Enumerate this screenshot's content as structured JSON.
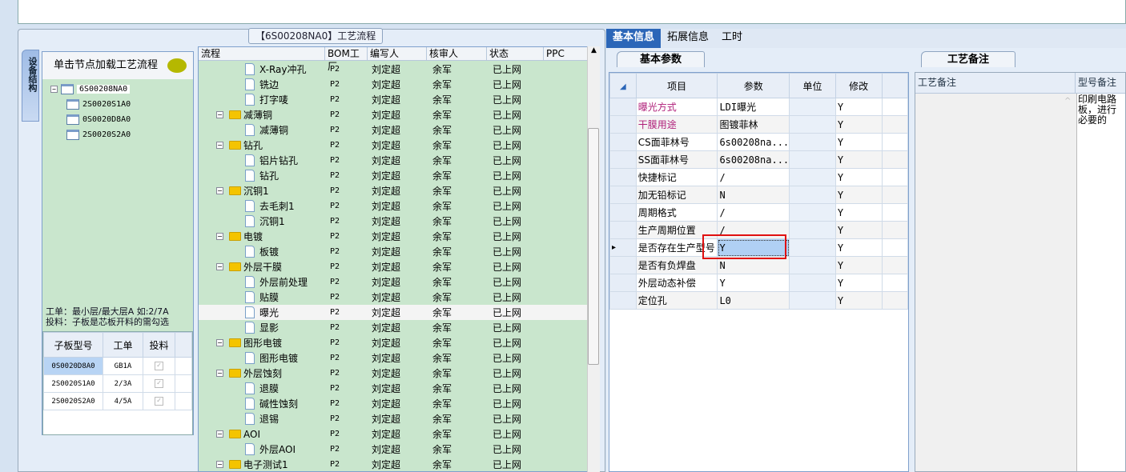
{
  "flow_title": "【6S00208NA0】工艺流程",
  "side_tab": "设备结构",
  "tree": {
    "header": "单击节点加载工艺流程",
    "root": "6S00208NA0",
    "children": [
      "2S0020S1A0",
      "0S0020D8A0",
      "2S0020S2A0"
    ]
  },
  "hint": [
    "工单：最小层/最大层A 如:2/7A",
    "投料：子板是芯板开料的需勾选"
  ],
  "sub_table": {
    "headers": [
      "子板型号",
      "工单",
      "投料"
    ],
    "rows": [
      [
        "0S0020D8A0",
        "GB1A",
        true
      ],
      [
        "2S0020S1A0",
        "2/3A",
        true
      ],
      [
        "2S0020S2A0",
        "4/5A",
        true
      ]
    ]
  },
  "flow_table": {
    "headers": [
      "流程",
      "BOM工厂",
      "编写人",
      "核审人",
      "状态",
      "PPC"
    ],
    "rows": [
      {
        "name": "X-Ray冲孔",
        "type": "leaf"
      },
      {
        "name": "铣边",
        "type": "leaf"
      },
      {
        "name": "打字唛",
        "type": "leaf"
      },
      {
        "name": "减薄铜",
        "type": "folder"
      },
      {
        "name": "减薄铜",
        "type": "leaf"
      },
      {
        "name": "钻孔",
        "type": "folder"
      },
      {
        "name": "铝片钻孔",
        "type": "leaf"
      },
      {
        "name": "钻孔",
        "type": "leaf"
      },
      {
        "name": "沉铜1",
        "type": "folder"
      },
      {
        "name": "去毛刺1",
        "type": "leaf"
      },
      {
        "name": "沉铜1",
        "type": "leaf"
      },
      {
        "name": "电镀",
        "type": "folder"
      },
      {
        "name": "板镀",
        "type": "leaf"
      },
      {
        "name": "外层干膜",
        "type": "folder"
      },
      {
        "name": "外层前处理",
        "type": "leaf"
      },
      {
        "name": "贴膜",
        "type": "leaf"
      },
      {
        "name": "曝光",
        "type": "leaf",
        "selected": true
      },
      {
        "name": "显影",
        "type": "leaf"
      },
      {
        "name": "图形电镀",
        "type": "folder"
      },
      {
        "name": "图形电镀",
        "type": "leaf"
      },
      {
        "name": "外层蚀刻",
        "type": "folder"
      },
      {
        "name": "退膜",
        "type": "leaf"
      },
      {
        "name": "碱性蚀刻",
        "type": "leaf"
      },
      {
        "name": "退锡",
        "type": "leaf"
      },
      {
        "name": "AOI",
        "type": "folder"
      },
      {
        "name": "外层AOI",
        "type": "leaf"
      },
      {
        "name": "电子测试1",
        "type": "folder"
      }
    ],
    "factory": "P2",
    "writer": "刘定超",
    "reviewer": "余军",
    "status": "已上网"
  },
  "right_tabs": [
    "基本信息",
    "拓展信息",
    "工时"
  ],
  "param_tab": "基本参数",
  "param_table": {
    "headers": [
      "项目",
      "参数",
      "单位",
      "修改"
    ],
    "rows": [
      {
        "item": "曝光方式",
        "value": "LDI曝光",
        "mod": "Y",
        "highlight": true
      },
      {
        "item": "干膜用途",
        "value": "图镀菲林",
        "mod": "Y",
        "highlight": true
      },
      {
        "item": "CS面菲林号",
        "value": "6s00208na...",
        "mod": "Y"
      },
      {
        "item": "SS面菲林号",
        "value": "6s00208na...",
        "mod": "Y"
      },
      {
        "item": "快捷标记",
        "value": "/",
        "mod": "Y"
      },
      {
        "item": "加无铅标记",
        "value": "N",
        "mod": "Y"
      },
      {
        "item": "周期格式",
        "value": "/",
        "mod": "Y"
      },
      {
        "item": "生产周期位置",
        "value": "/",
        "mod": "Y"
      },
      {
        "item": "是否存在生产型号",
        "value": "Y",
        "mod": "Y",
        "current": true
      },
      {
        "item": "是否有负焊盘",
        "value": "N",
        "mod": "Y"
      },
      {
        "item": "外层动态补偿",
        "value": "Y",
        "mod": "Y"
      },
      {
        "item": "定位孔",
        "value": "L0",
        "mod": "Y"
      }
    ]
  },
  "notes_tab": "工艺备注",
  "notes_headers": [
    "工艺备注",
    "型号备注"
  ],
  "model_note": "印刷电路板，进行必要的",
  "colors": {
    "accent": "#2b66b8",
    "highlight_text": "#b0207a",
    "tree_bg": "#c9e6cd",
    "annotation": "#e01010"
  }
}
